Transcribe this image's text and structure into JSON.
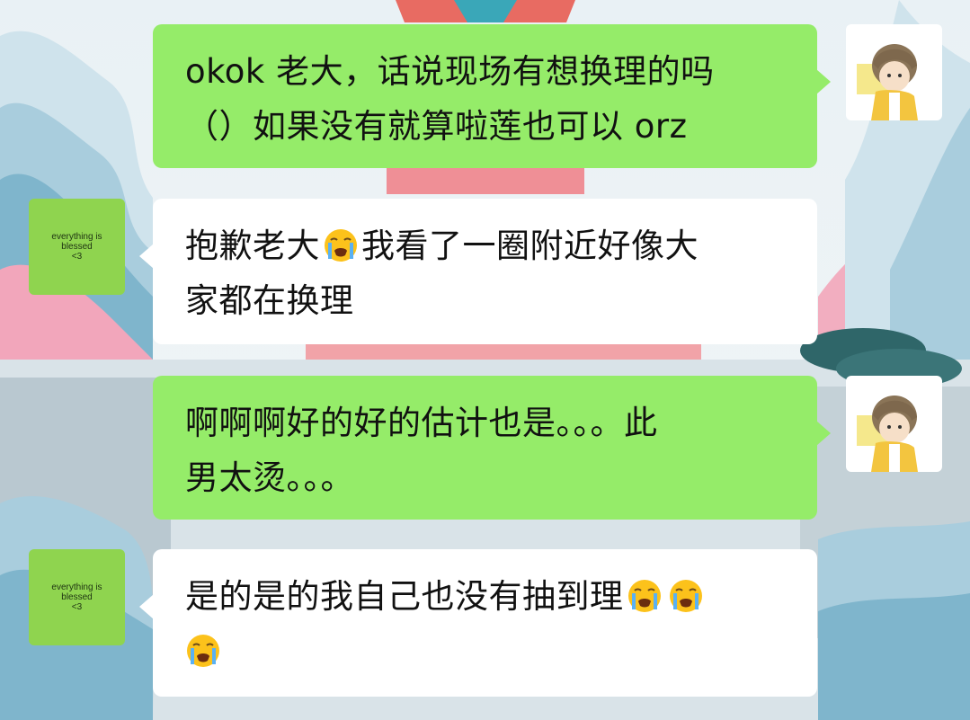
{
  "chat": {
    "messages": [
      {
        "sender": "me",
        "lines": [
          "okok 老大，话说现场有想换理的吗",
          "（）如果没有就算啦莲也可以 orz"
        ],
        "emojis": []
      },
      {
        "sender": "them",
        "avatar_text": "everything is\nblessed\n<3",
        "lines": [
          "抱歉老大",
          "我看了一圈附近好像大",
          "家都在换理"
        ],
        "emoji_after": "loudly-crying-face-icon"
      },
      {
        "sender": "me",
        "lines": [
          "啊啊啊好的好的估计也是。。。此",
          "男太烫。。。"
        ],
        "emojis": []
      },
      {
        "sender": "them",
        "avatar_text": "everything is\nblessed\n<3",
        "lines": [
          "是的是的我自己也没有抽到理"
        ],
        "emoji_count": 3,
        "emoji": "loudly-crying-face-icon"
      }
    ]
  },
  "colors": {
    "my_bubble": "#95ec69",
    "their_bubble": "#ffffff",
    "their_avatar": "#8fd44f"
  }
}
